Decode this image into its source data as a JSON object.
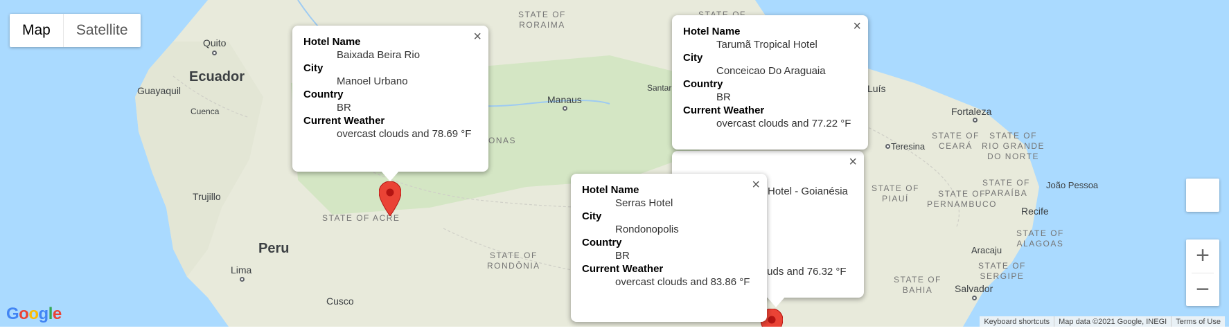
{
  "map_type": {
    "map_label": "Map",
    "satellite_label": "Satellite"
  },
  "labels": {
    "countries": [
      "Ecuador",
      "Peru"
    ],
    "states": {
      "roraima": "STATE OF\nRORAIMA",
      "acre": "STATE OF ACRE",
      "rondonia": "STATE OF\nRONDÔNIA",
      "amazonas_frag": "ONAS",
      "amazonas_frag2": "AS",
      "ceara": "STATE OF\nCEARÁ",
      "rio_grande": "STATE OF\nRIO GRANDE\nDO NORTE",
      "paraiba": "STATE OF\nPARAÍBA",
      "pernambuco": "STATE OF\nPERNAMBUCO",
      "piaui": "STATE OF\nPIAUÍ",
      "alagoas": "STATE OF\nALAGOAS",
      "sergipe": "STATE OF\nSERGIPE",
      "bahia": "STATE OF\nBAHIA",
      "para_top": "STATE OF"
    },
    "cities": {
      "quito": "Quito",
      "guayaquil": "Guayaquil",
      "cuenca": "Cuenca",
      "trujillo": "Trujillo",
      "lima": "Lima",
      "cusco": "Cusco",
      "manaus": "Manaus",
      "santarem": "Santar",
      "sao_luis": "Luís",
      "fortaleza": "Fortaleza",
      "teresina": "Teresina",
      "joao_pessoa": "João Pessoa",
      "recife": "Recife",
      "aracaju": "Aracaju",
      "salvador": "Salvador"
    }
  },
  "info_windows": [
    {
      "hotel_label": "Hotel Name",
      "hotel": "Baixada Beira Rio",
      "city_label": "City",
      "city": "Manoel Urbano",
      "country_label": "Country",
      "country": "BR",
      "weather_label": "Current Weather",
      "weather": "overcast clouds and 78.69 °F"
    },
    {
      "hotel_label": "Hotel Name",
      "hotel": "Tarumã Tropical Hotel",
      "city_label": "City",
      "city": "Conceicao Do Araguaia",
      "country_label": "Country",
      "country": "BR",
      "weather_label": "Current Weather",
      "weather": "overcast clouds and 77.22 °F"
    },
    {
      "hotel_frag": "za Hotel - Goianésia",
      "weather_frag": "clouds and 76.32 °F"
    },
    {
      "hotel_label": "Hotel Name",
      "hotel": "Serras Hotel",
      "city_label": "City",
      "city": "Rondonopolis",
      "country_label": "Country",
      "country": "BR",
      "weather_label": "Current Weather",
      "weather": "overcast clouds and 83.86 °F"
    }
  ],
  "close_glyph": "×",
  "zoom": {
    "in": "+",
    "out": "−"
  },
  "attribution": {
    "shortcuts": "Keyboard shortcuts",
    "data": "Map data ©2021 Google, INEGI",
    "terms": "Terms of Use"
  },
  "logo": {
    "g": "G",
    "o1": "o",
    "o2": "o",
    "g2": "g",
    "l": "l",
    "e": "e"
  },
  "colors": {
    "water": "#aadaff",
    "land": "#e8eadb",
    "forest": "#d4e6c4",
    "marker": "#ea4335"
  }
}
